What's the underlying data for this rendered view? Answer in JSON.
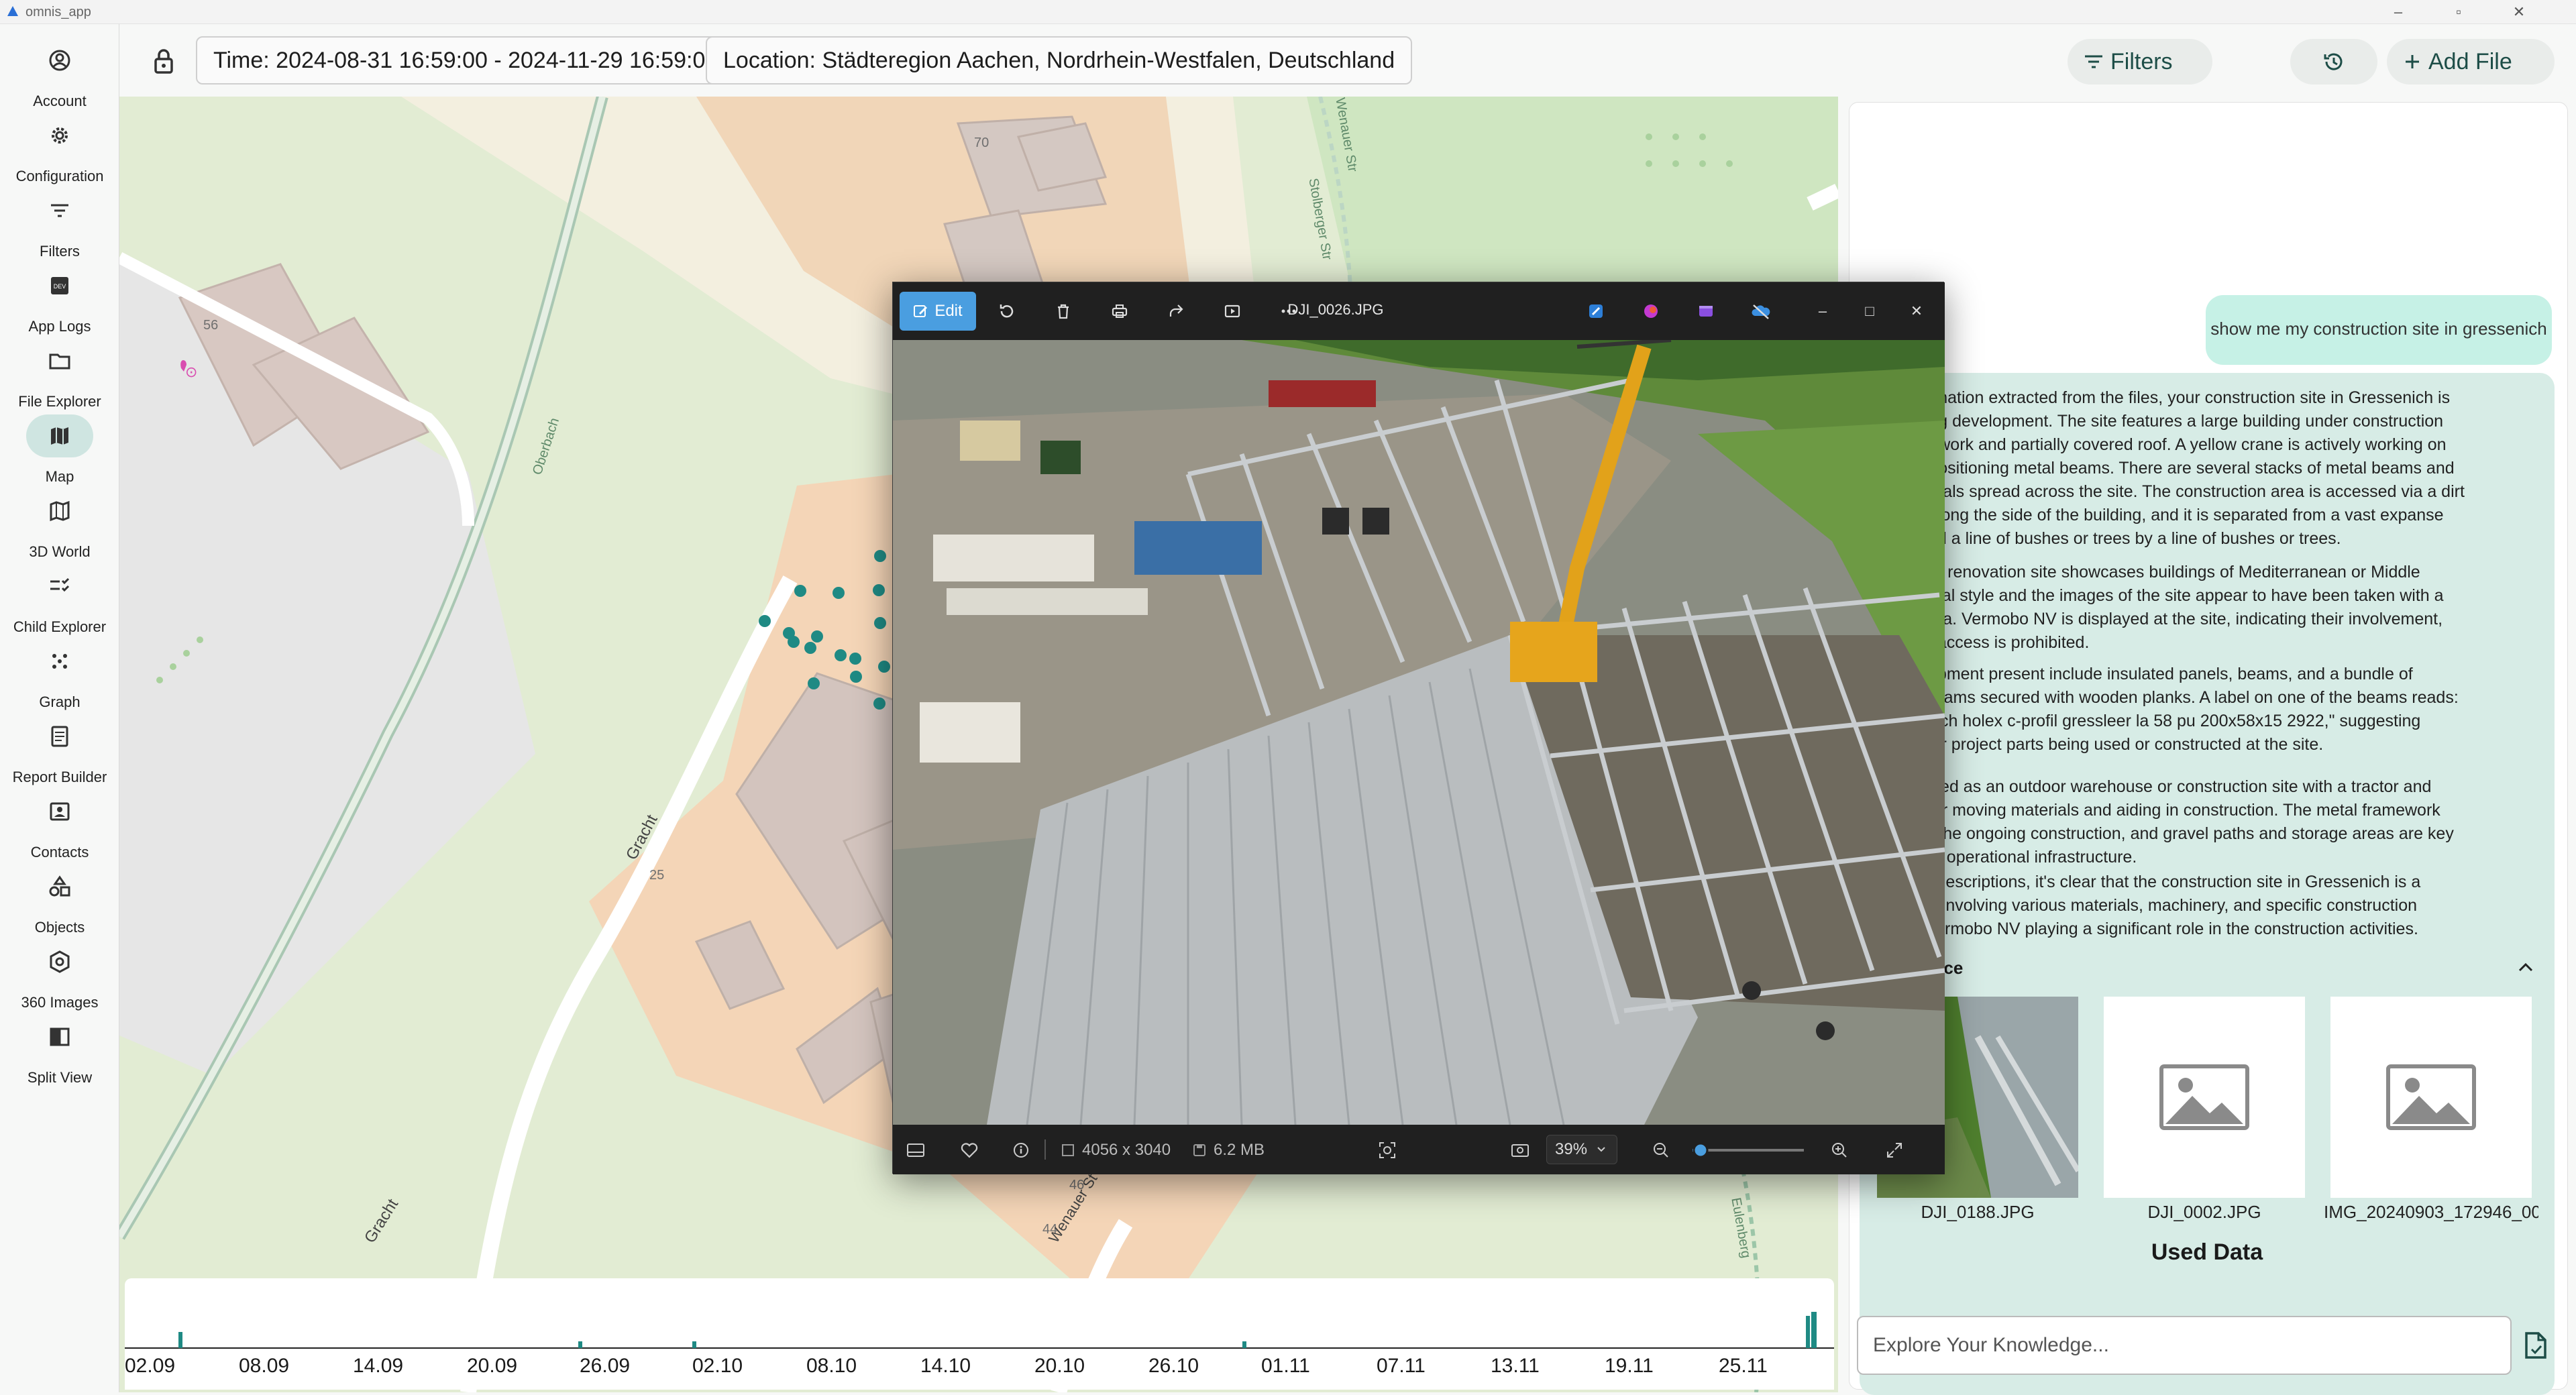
{
  "window": {
    "title": "omnis_app"
  },
  "sidebar": {
    "items": [
      {
        "label": "Account",
        "icon": "account-icon"
      },
      {
        "label": "Configuration",
        "icon": "gear-icon"
      },
      {
        "label": "Filters",
        "icon": "filter-icon"
      },
      {
        "label": "App Logs",
        "icon": "dev-icon"
      },
      {
        "label": "File Explorer",
        "icon": "folder-icon"
      },
      {
        "label": "Map",
        "icon": "map-icon",
        "active": true
      },
      {
        "label": "3D World",
        "icon": "map-outline-icon"
      },
      {
        "label": "Child Explorer",
        "icon": "checklist-icon"
      },
      {
        "label": "Graph",
        "icon": "graph-icon"
      },
      {
        "label": "Report Builder",
        "icon": "report-icon"
      },
      {
        "label": "Contacts",
        "icon": "contacts-icon"
      },
      {
        "label": "Objects",
        "icon": "shapes-icon"
      },
      {
        "label": "360 Images",
        "icon": "360-icon"
      },
      {
        "label": "Split View",
        "icon": "split-icon"
      }
    ]
  },
  "topbar": {
    "time_filter": "Time: 2024-08-31 16:59:00 - 2024-11-29 16:59:00",
    "location_filter": "Location: Städteregion Aachen, Nordrhein-Westfalen, Deutschland",
    "filters_label": "Filters",
    "add_file_label": "Add File"
  },
  "map": {
    "labels": [
      "Gracht",
      "Gracht",
      "Oberbach",
      "Wenauer St",
      "Eulenberg",
      "Stolberger Str",
      "Wenauer Str"
    ],
    "house_numbers": [
      "56",
      "25",
      "46",
      "44",
      "70"
    ],
    "accent": "#1f8a84"
  },
  "timeline": {
    "ticks": [
      "02.09",
      "08.09",
      "14.09",
      "20.09",
      "26.09",
      "02.10",
      "08.10",
      "14.10",
      "20.10",
      "26.10",
      "01.11",
      "07.11",
      "13.11",
      "19.11",
      "25.11"
    ]
  },
  "viewer": {
    "edit_label": "Edit",
    "file_name": "DJI_0026.JPG",
    "dimensions": "4056 x 3040",
    "file_size": "6.2 MB",
    "zoom": "39%"
  },
  "chat": {
    "user_message": "show me my construction site in gressenich",
    "answer_paragraphs": [
      "the information extracted from the files, your construction site in Gressenich is\nndergoing development. The site features a large building under construction\ntal framework and partially covered roof. A yellow crane is actively working on\nfting or positioning metal beams. There are several stacks of metal beams and\non materials spread across the site. The construction area is accessed via a dirt\nunning along the side of the building, and it is separated from a vast expanse\ngrass and a line of bushes or trees by a line of bushes or trees.",
      "ruction or renovation site showcases buildings of Mediterranean or Middle\nrchitectural style and the images of the site appear to have been taken with a\nee camera. Vermobo NV is displayed at the site, indicating their involvement,\nthorized access is prohibited.",
      "and equipment present include insulated panels, beams, and a bundle of\nupport beams secured with wooden planks. A label on one of the beams reads:\ntung j. pilch holex c-profil gressleer la 58 pu 200x58x15 2922,\" suggesting\naterials or project parts being used or constructed at the site.",
      "s described as an outdoor warehouse or construction site with a tractor and\ng used for moving materials and aiding in construction. The metal framework\ns part of the ongoing construction, and gravel paths and storage areas are key\nnts of the operational infrastructure.",
      "detailed descriptions, it's clear that the construction site in Gressenich is a\ne project involving various materials, machinery, and specific construction\ns, with Vermobo NV playing a significant role in the construction activities."
    ],
    "source_title": "ion Source",
    "sources": [
      "DJI_0188.JPG",
      "DJI_0002.JPG",
      "IMG_20240903_172946_00_0..."
    ],
    "used_data_label": "Used Data",
    "input_placeholder": "Explore Your Knowledge..."
  }
}
